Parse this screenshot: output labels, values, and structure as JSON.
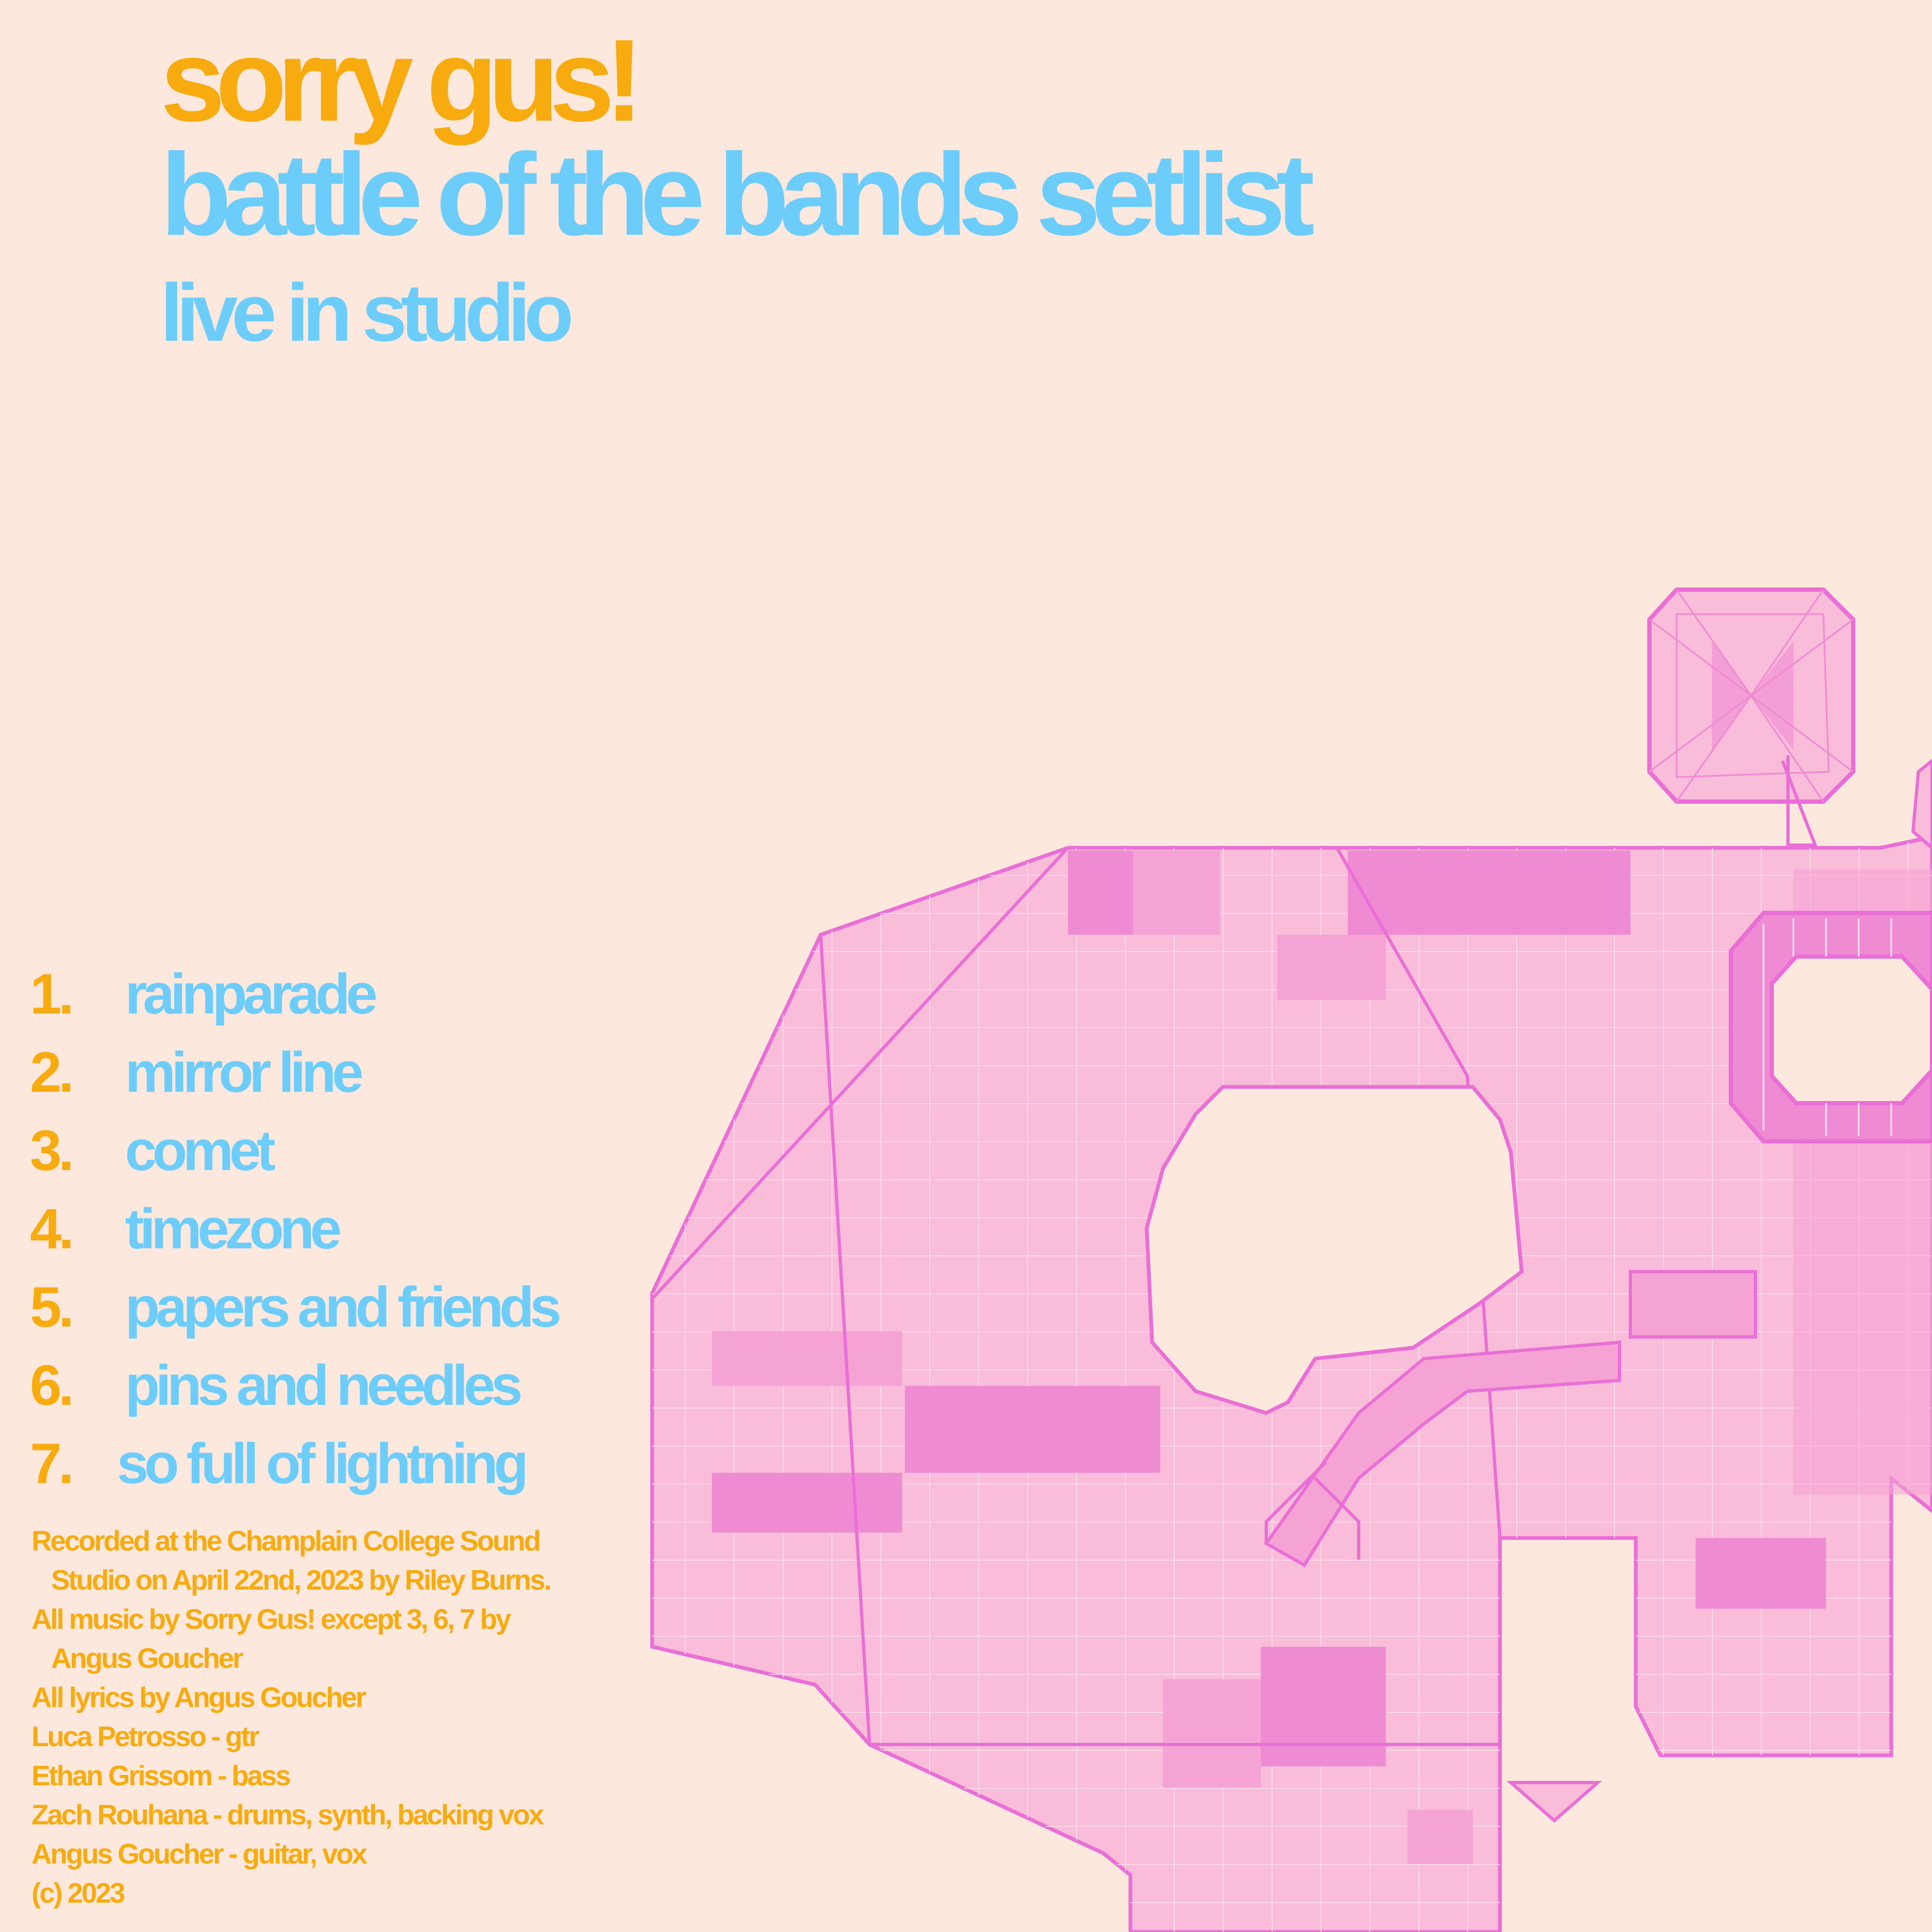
{
  "header": {
    "band": "sorry gus!",
    "album": "battle of the bands setlist",
    "subtitle": "live in studio"
  },
  "tracks": [
    {
      "num": "1.",
      "title": "rainparade"
    },
    {
      "num": "2.",
      "title": "mirror line"
    },
    {
      "num": "3.",
      "title": "comet"
    },
    {
      "num": "4.",
      "title": "timezone"
    },
    {
      "num": "5.",
      "title": "papers and friends"
    },
    {
      "num": "6.",
      "title": "pins and needles"
    },
    {
      "num": "7.",
      "title": "so full of lightning"
    }
  ],
  "credits": [
    "Recorded at the Champlain College Sound",
    "Studio on April 22nd, 2023 by Riley Burns.",
    "All music by Sorry Gus! except 3, 6, 7 by",
    "Angus Goucher",
    "All lyrics by Angus Goucher",
    "Luca Petrosso - gtr",
    "Ethan Grissom - bass",
    "Zach Rouhana - drums, synth, backing vox",
    "Angus Goucher - guitar, vox",
    "(c) 2023"
  ],
  "colors": {
    "background": "#fde8de",
    "orange": "#f7ab0f",
    "blue": "#6dcdfa",
    "pink_light": "#f9bcd9",
    "pink_mid": "#f5a3d4",
    "pink_dark": "#ef8bd3",
    "pink_outline": "#e96fd6"
  },
  "artwork": "pink-wireframe-3d-shape"
}
